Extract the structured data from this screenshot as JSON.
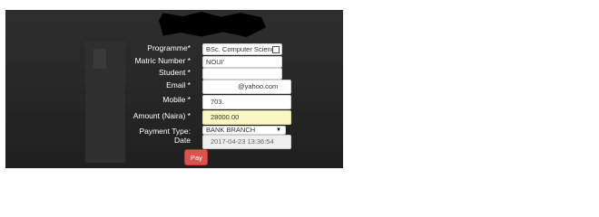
{
  "form": {
    "programme": {
      "label": "Programme*",
      "value": "BSc. Computer Science"
    },
    "matric": {
      "label": "Matric Number *",
      "value": "NOUI'"
    },
    "student": {
      "label": "Student *",
      "value": ""
    },
    "email": {
      "label": "Email *",
      "value": "@yahoo.com"
    },
    "mobile": {
      "label": "Mobile *",
      "value": "703."
    },
    "amount": {
      "label": "Amount (Naira) *",
      "value": "28000.00"
    },
    "payment_type": {
      "label": "Payment Type:",
      "value": "BANK BRANCH"
    },
    "date": {
      "label": "Date",
      "value": "2017-04-23 13:36:54"
    },
    "pay_button": "Pay"
  },
  "colors": {
    "panel_bg": "#262626",
    "amount_highlight": "#fbf6c6",
    "pay_button": "#d9534f"
  }
}
